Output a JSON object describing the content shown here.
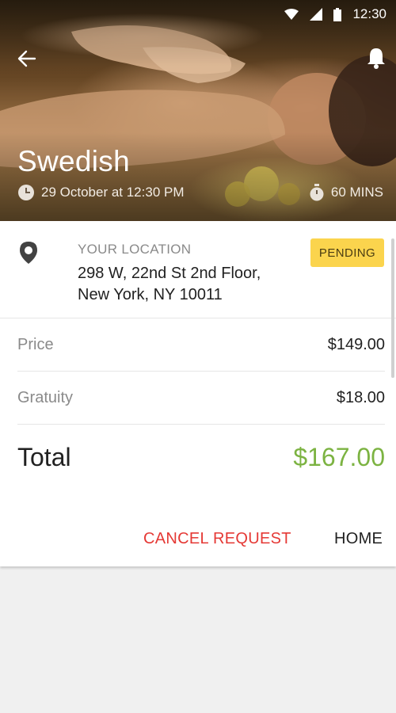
{
  "status_bar": {
    "time": "12:30",
    "icons": [
      "wifi-icon",
      "signal-icon",
      "battery-icon"
    ]
  },
  "header": {
    "back_icon": "arrow-left-icon",
    "notification_icon": "bell-icon",
    "title": "Swedish",
    "datetime": "29 October at 12:30 PM",
    "datetime_icon": "clock-icon",
    "duration": "60 MINS",
    "duration_icon": "stopwatch-icon"
  },
  "location": {
    "icon": "map-pin-icon",
    "label": "YOUR LOCATION",
    "address_line1": "298 W, 22nd St 2nd Floor,",
    "address_line2": "New York, NY 10011",
    "status_badge": "PENDING"
  },
  "pricing": {
    "price_label": "Price",
    "price_value": "$149.00",
    "gratuity_label": "Gratuity",
    "gratuity_value": "$18.00",
    "total_label": "Total",
    "total_value": "$167.00"
  },
  "actions": {
    "cancel_label": "CANCEL REQUEST",
    "home_label": "HOME"
  },
  "colors": {
    "accent_total": "#7cb342",
    "cancel": "#e53935",
    "badge": "#fbd44d"
  }
}
